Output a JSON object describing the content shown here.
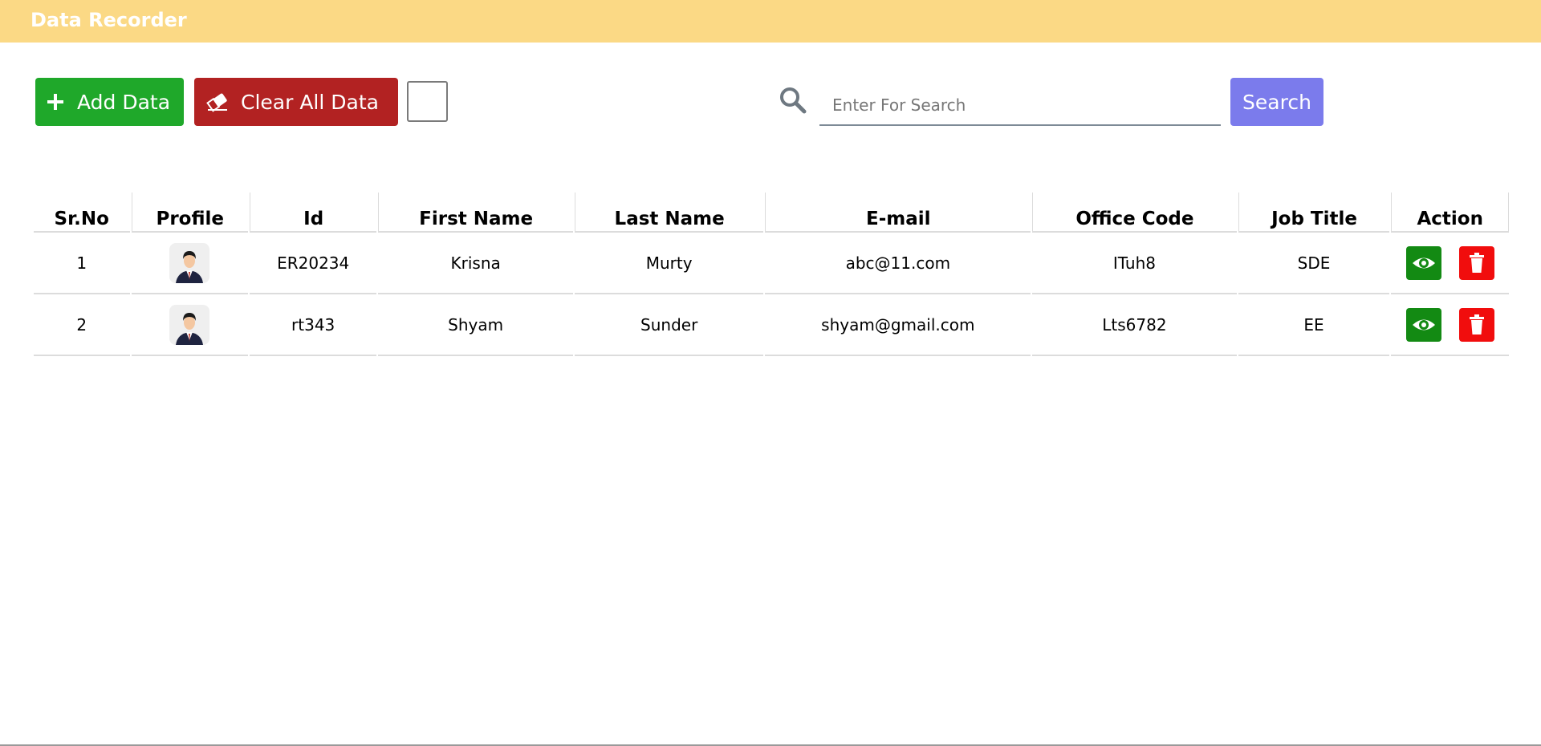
{
  "app": {
    "title": "Data Recorder"
  },
  "toolbar": {
    "add_label": "Add Data",
    "clear_label": "Clear All Data",
    "add_icon": "plus-icon",
    "clear_icon": "eraser-icon"
  },
  "search": {
    "placeholder": "Enter For Search",
    "value": "",
    "button_label": "Search",
    "icon": "search-icon"
  },
  "table": {
    "headers": [
      "Sr.No",
      "Profile",
      "Id",
      "First Name",
      "Last Name",
      "E-mail",
      "Office Code",
      "Job Title",
      "Action"
    ],
    "rows": [
      {
        "sr": "1",
        "profile": "avatar-icon",
        "id": "ER20234",
        "first_name": "Krisna",
        "last_name": "Murty",
        "email": "abc@11.com",
        "office_code": "ITuh8",
        "job_title": "SDE"
      },
      {
        "sr": "2",
        "profile": "avatar-icon",
        "id": "rt343",
        "first_name": "Shyam",
        "last_name": "Sunder",
        "email": "shyam@gmail.com",
        "office_code": "Lts6782",
        "job_title": "EE"
      }
    ]
  },
  "colors": {
    "header_bar": "#fbd985",
    "add_button": "#1fa82a",
    "clear_button": "#b22222",
    "search_button": "#7b7bec",
    "view_button": "#138a13",
    "delete_button": "#f10d0d"
  }
}
